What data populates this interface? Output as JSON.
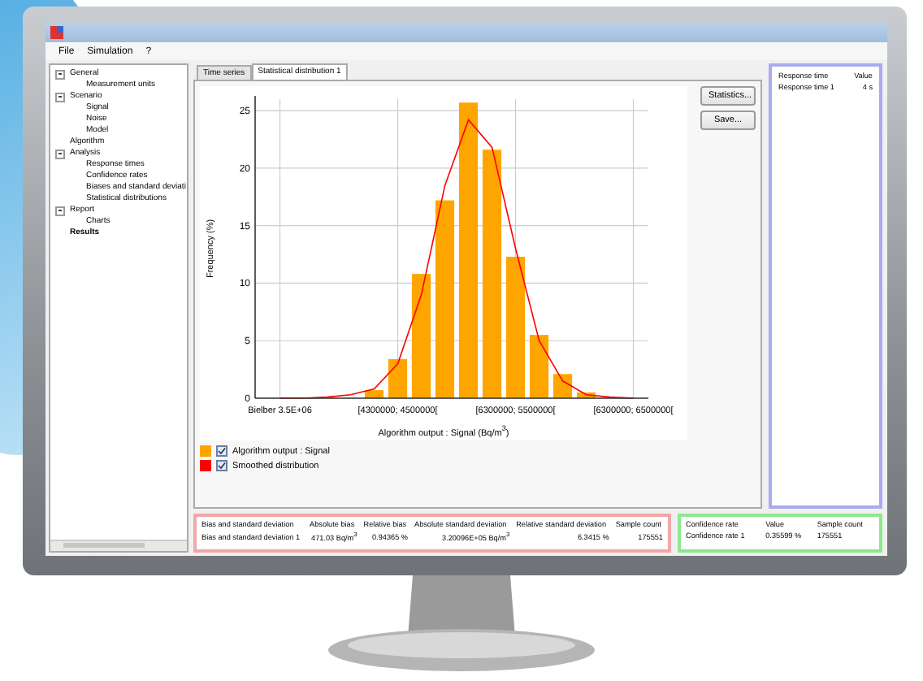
{
  "window": {
    "menu": [
      "File",
      "Simulation",
      "?"
    ]
  },
  "sidebar": {
    "tree": [
      {
        "label": "General",
        "expanded": true,
        "selected": false,
        "children": [
          {
            "label": "Measurement units",
            "selected": false
          }
        ]
      },
      {
        "label": "Scenario",
        "expanded": true,
        "selected": false,
        "children": [
          {
            "label": "Signal",
            "selected": false
          },
          {
            "label": "Noise",
            "selected": false
          },
          {
            "label": "Model",
            "selected": false
          }
        ]
      },
      {
        "label": "Algorithm",
        "selected": false
      },
      {
        "label": "Analysis",
        "expanded": true,
        "selected": false,
        "children": [
          {
            "label": "Response times",
            "selected": false
          },
          {
            "label": "Confidence rates",
            "selected": false
          },
          {
            "label": "Biases and standard deviati",
            "selected": false
          },
          {
            "label": "Statistical distributions",
            "selected": false
          }
        ]
      },
      {
        "label": "Report",
        "expanded": true,
        "selected": false,
        "children": [
          {
            "label": "Charts",
            "selected": false
          }
        ]
      },
      {
        "label": "Results",
        "selected": true
      }
    ]
  },
  "tabs": [
    {
      "label": "Time series",
      "selected": false
    },
    {
      "label": "Statistical distribution 1",
      "selected": true
    }
  ],
  "chart": {
    "chart_data": {
      "type": "bar",
      "xlabel": "Algorithm output : Signal (Bq/m$^{3}$)",
      "ylabel": "Frequency (%)",
      "categories": [
        "Bielber 3.5E+06",
        null,
        null,
        null,
        null,
        "[4300000; 4500000[",
        null,
        null,
        null,
        null,
        "[6300000; 5500000[",
        null,
        null,
        null,
        null,
        "[6300000; 6500000["
      ],
      "series": [
        {
          "name": "Algorithm output : Signal",
          "color": "#ffa500",
          "values": [
            0,
            0,
            0,
            null,
            0.7,
            3.4,
            10.8,
            17.2,
            25.7,
            21.6,
            12.3,
            5.5,
            2.1,
            0.5,
            null,
            0
          ]
        },
        {
          "name": "Smoothed distribution",
          "type": "line",
          "color": "#ff0000",
          "values": [
            0,
            0,
            0.1,
            0.3,
            0.8,
            3,
            9,
            18.5,
            24.2,
            21.8,
            13,
            5,
            1.5,
            0.3,
            0.1,
            0
          ]
        }
      ],
      "ylim": [
        0,
        26
      ],
      "grid": true,
      "yticks": [
        0,
        5,
        10,
        15,
        20,
        25
      ]
    },
    "legend": [
      {
        "checked": true
      },
      {
        "checked": true
      }
    ]
  },
  "buttons": [
    "Statistics...",
    "Save..."
  ],
  "response_table": {
    "columns": [
      "Response time",
      "Value"
    ],
    "rows": [
      [
        "Response time 1",
        "4 s"
      ]
    ]
  },
  "bias_table": {
    "columns": [
      "Bias and standard deviation",
      "Absolute bias",
      "Relative bias",
      "Absolute standard deviation",
      "Relative standard deviation",
      "Sample count"
    ],
    "rows": [
      [
        "Bias and standard deviation 1",
        "471.03 Bq/m$^{3}$",
        "0.94365 %",
        "3.20096E+05 Bq/m$^{3}$",
        "6.3415 %",
        "175551"
      ]
    ]
  },
  "confidence_table": {
    "columns": [
      "Confidence rate",
      "Value",
      "Sample count"
    ],
    "rows": [
      [
        "Confidence rate 1",
        "0.35599 %",
        "175551"
      ]
    ]
  }
}
